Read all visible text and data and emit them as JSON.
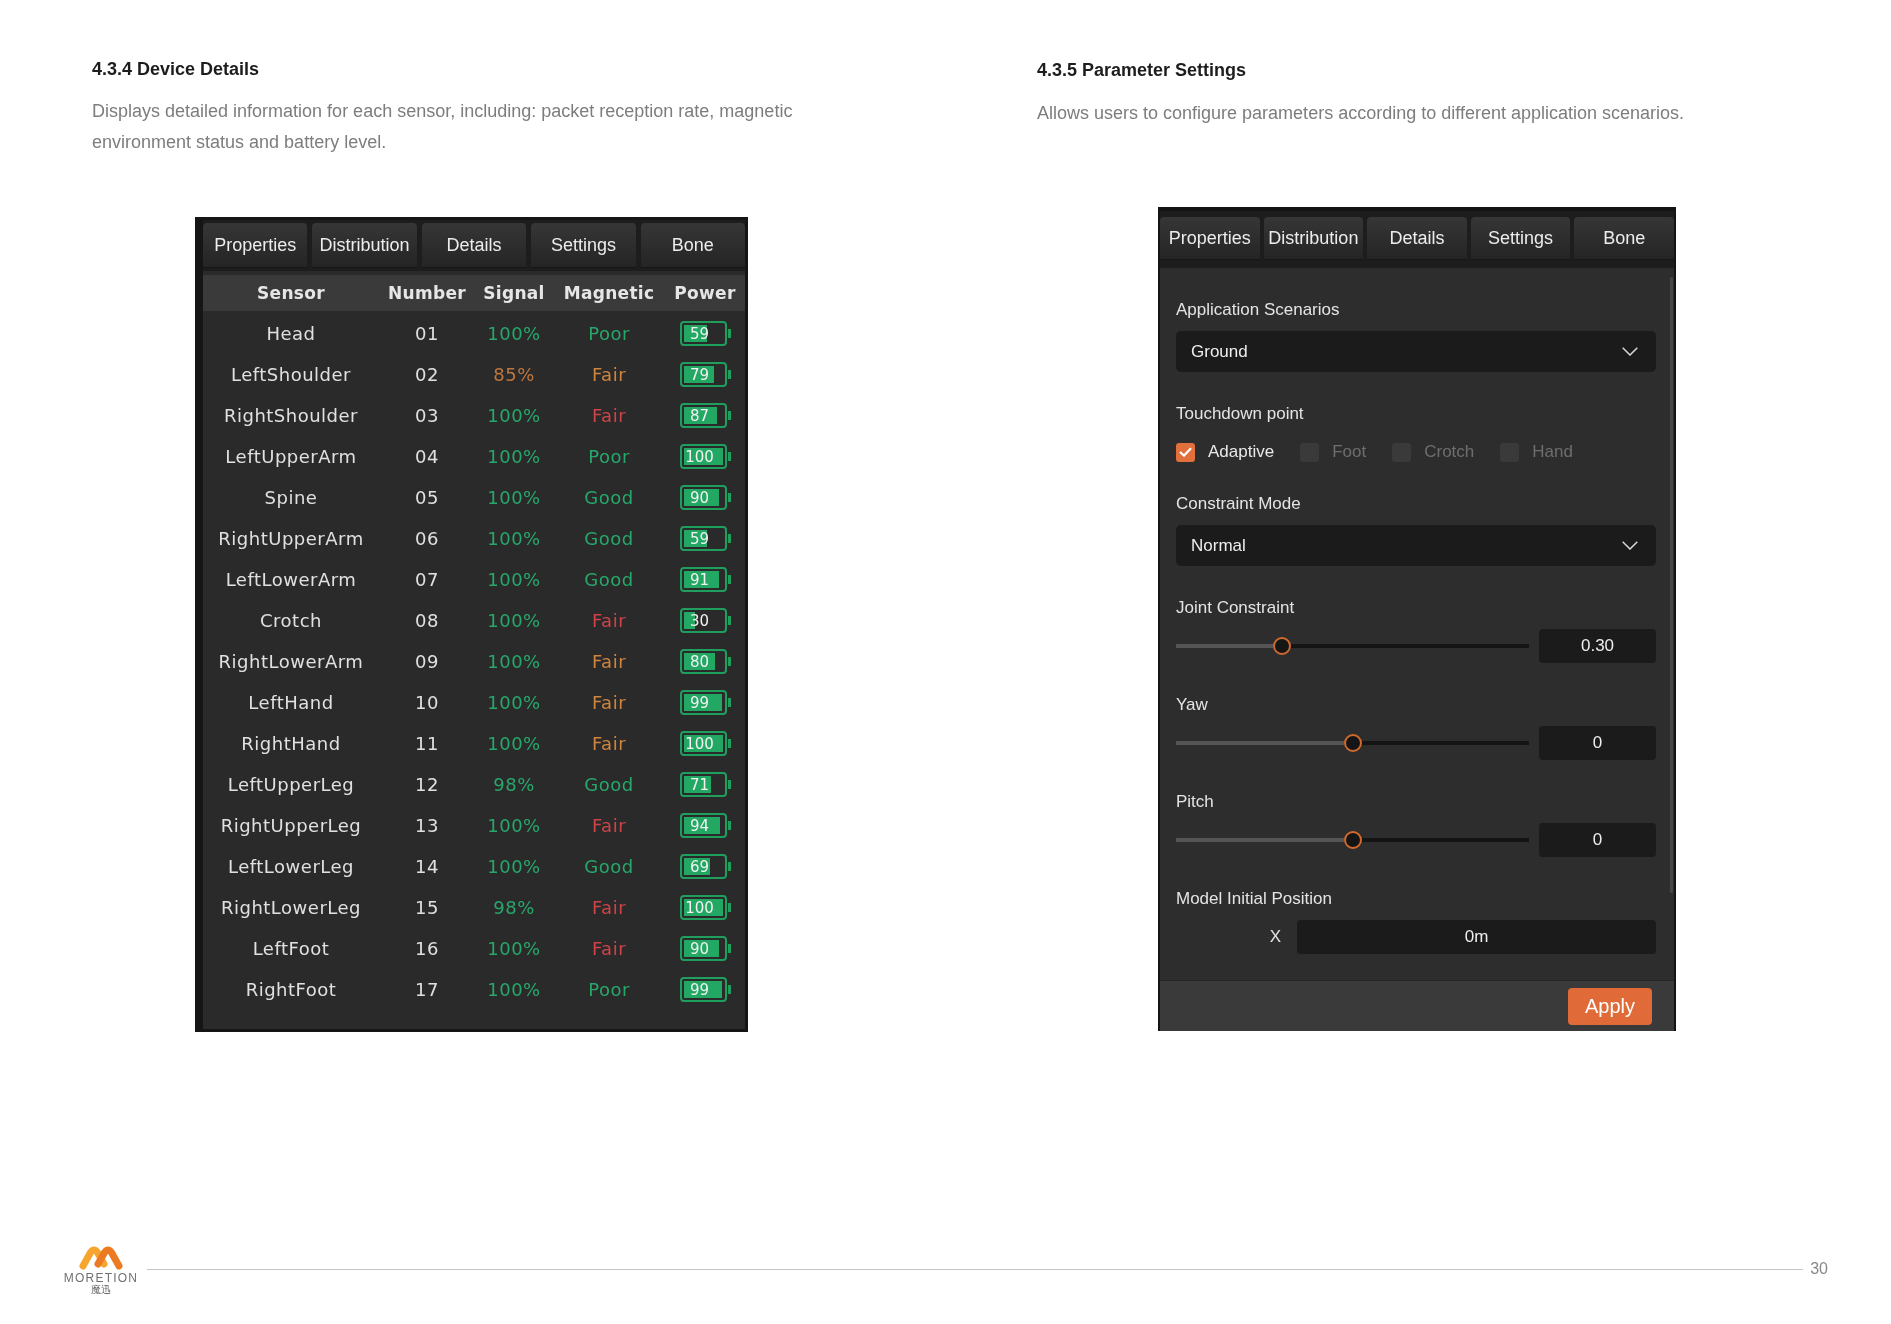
{
  "device_details": {
    "heading": "4.3.4 Device Details",
    "description": "Displays detailed information for each sensor, including: packet reception rate, magnetic environment status and battery level.",
    "panel": {
      "tabs": [
        {
          "label": "Properties",
          "selected": false
        },
        {
          "label": "Distribution",
          "selected": false
        },
        {
          "label": "Details",
          "selected": false
        },
        {
          "label": "Settings",
          "selected": false
        },
        {
          "label": "Bone",
          "selected": false
        }
      ],
      "table": {
        "columns": [
          "Sensor",
          "Number",
          "Signal",
          "Magnetic",
          "Power"
        ],
        "rows": [
          {
            "sensor": "Head",
            "number": "01",
            "signal": {
              "text": "100%",
              "color": "#27a86b"
            },
            "magnetic": {
              "text": "Poor",
              "color": "#27a86b"
            },
            "power": {
              "text": "59",
              "level": 0.59
            }
          },
          {
            "sensor": "LeftShoulder",
            "number": "02",
            "signal": {
              "text": "85%",
              "color": "#c0773f"
            },
            "magnetic": {
              "text": "Fair",
              "color": "#cf853c"
            },
            "power": {
              "text": "79",
              "level": 0.79
            }
          },
          {
            "sensor": "RightShoulder",
            "number": "03",
            "signal": {
              "text": "100%",
              "color": "#27a86b"
            },
            "magnetic": {
              "text": "Fair",
              "color": "#cc4448"
            },
            "power": {
              "text": "87",
              "level": 0.87
            }
          },
          {
            "sensor": "LeftUpperArm",
            "number": "04",
            "signal": {
              "text": "100%",
              "color": "#27a86b"
            },
            "magnetic": {
              "text": "Poor",
              "color": "#27a86b"
            },
            "power": {
              "text": "100",
              "level": 1
            }
          },
          {
            "sensor": "Spine",
            "number": "05",
            "signal": {
              "text": "100%",
              "color": "#27a86b"
            },
            "magnetic": {
              "text": "Good",
              "color": "#27a86b"
            },
            "power": {
              "text": "90",
              "level": 0.9
            }
          },
          {
            "sensor": "RightUpperArm",
            "number": "06",
            "signal": {
              "text": "100%",
              "color": "#27a86b"
            },
            "magnetic": {
              "text": "Good",
              "color": "#27a86b"
            },
            "power": {
              "text": "59",
              "level": 0.59
            }
          },
          {
            "sensor": "LeftLowerArm",
            "number": "07",
            "signal": {
              "text": "100%",
              "color": "#27a86b"
            },
            "magnetic": {
              "text": "Good",
              "color": "#27a86b"
            },
            "power": {
              "text": "91",
              "level": 0.91
            }
          },
          {
            "sensor": "Crotch",
            "number": "08",
            "signal": {
              "text": "100%",
              "color": "#27a86b"
            },
            "magnetic": {
              "text": "Fair",
              "color": "#cc4448"
            },
            "power": {
              "text": "30",
              "level": 0.3
            }
          },
          {
            "sensor": "RightLowerArm",
            "number": "09",
            "signal": {
              "text": "100%",
              "color": "#27a86b"
            },
            "magnetic": {
              "text": "Fair",
              "color": "#cf853c"
            },
            "power": {
              "text": "80",
              "level": 0.8
            }
          },
          {
            "sensor": "LeftHand",
            "number": "10",
            "signal": {
              "text": "100%",
              "color": "#27a86b"
            },
            "magnetic": {
              "text": "Fair",
              "color": "#cf853c"
            },
            "power": {
              "text": "99",
              "level": 0.99
            }
          },
          {
            "sensor": "RightHand",
            "number": "11",
            "signal": {
              "text": "100%",
              "color": "#27a86b"
            },
            "magnetic": {
              "text": "Fair",
              "color": "#cf853c"
            },
            "power": {
              "text": "100",
              "level": 1
            }
          },
          {
            "sensor": "LeftUpperLeg",
            "number": "12",
            "signal": {
              "text": "98%",
              "color": "#27a86b"
            },
            "magnetic": {
              "text": "Good",
              "color": "#27a86b"
            },
            "power": {
              "text": "71",
              "level": 0.71
            }
          },
          {
            "sensor": "RightUpperLeg",
            "number": "13",
            "signal": {
              "text": "100%",
              "color": "#27a86b"
            },
            "magnetic": {
              "text": "Fair",
              "color": "#cc4448"
            },
            "power": {
              "text": "94",
              "level": 0.94
            }
          },
          {
            "sensor": "LeftLowerLeg",
            "number": "14",
            "signal": {
              "text": "100%",
              "color": "#27a86b"
            },
            "magnetic": {
              "text": "Good",
              "color": "#27a86b"
            },
            "power": {
              "text": "69",
              "level": 0.69
            }
          },
          {
            "sensor": "RightLowerLeg",
            "number": "15",
            "signal": {
              "text": "98%",
              "color": "#27a86b"
            },
            "magnetic": {
              "text": "Fair",
              "color": "#cc4448"
            },
            "power": {
              "text": "100",
              "level": 1
            }
          },
          {
            "sensor": "LeftFoot",
            "number": "16",
            "signal": {
              "text": "100%",
              "color": "#27a86b"
            },
            "magnetic": {
              "text": "Fair",
              "color": "#cc4448"
            },
            "power": {
              "text": "90",
              "level": 0.9
            }
          },
          {
            "sensor": "RightFoot",
            "number": "17",
            "signal": {
              "text": "100%",
              "color": "#27a86b"
            },
            "magnetic": {
              "text": "Poor",
              "color": "#27a86b"
            },
            "power": {
              "text": "99",
              "level": 0.99
            }
          }
        ]
      }
    }
  },
  "parameter_settings": {
    "heading": "4.3.5 Parameter Settings",
    "description": "Allows users to configure parameters according to different application scenarios.",
    "panel": {
      "tabs": [
        {
          "label": "Properties",
          "selected": false
        },
        {
          "label": "Distribution",
          "selected": false
        },
        {
          "label": "Details",
          "selected": false
        },
        {
          "label": "Settings",
          "selected": false
        },
        {
          "label": "Bone",
          "selected": false
        }
      ],
      "sections": [
        {
          "kind": "dropdown",
          "label": "Application Scenarios",
          "value": "Ground"
        },
        {
          "kind": "checkboxes",
          "label": "Touchdown point",
          "options": [
            {
              "label": "Adaptive",
              "checked": true
            },
            {
              "label": "Foot",
              "checked": false
            },
            {
              "label": "Crotch",
              "checked": false
            },
            {
              "label": "Hand",
              "checked": false
            }
          ]
        },
        {
          "kind": "dropdown",
          "label": "Constraint Mode",
          "value": "Normal"
        },
        {
          "kind": "slider",
          "label": "Joint Constraint",
          "level": 0.3,
          "value": "0.30"
        },
        {
          "kind": "slider",
          "label": "Yaw",
          "level": 0.5,
          "value": "0"
        },
        {
          "kind": "slider",
          "label": "Pitch",
          "level": 0.5,
          "value": "0"
        },
        {
          "kind": "position",
          "label": "Model Initial Position",
          "fields": [
            {
              "axis": "X",
              "value": "0m"
            }
          ]
        }
      ],
      "apply_button": "Apply"
    }
  },
  "footer": {
    "logo_text": "MORETION",
    "logo_subtitle": "魔迅",
    "page_number": "30"
  }
}
